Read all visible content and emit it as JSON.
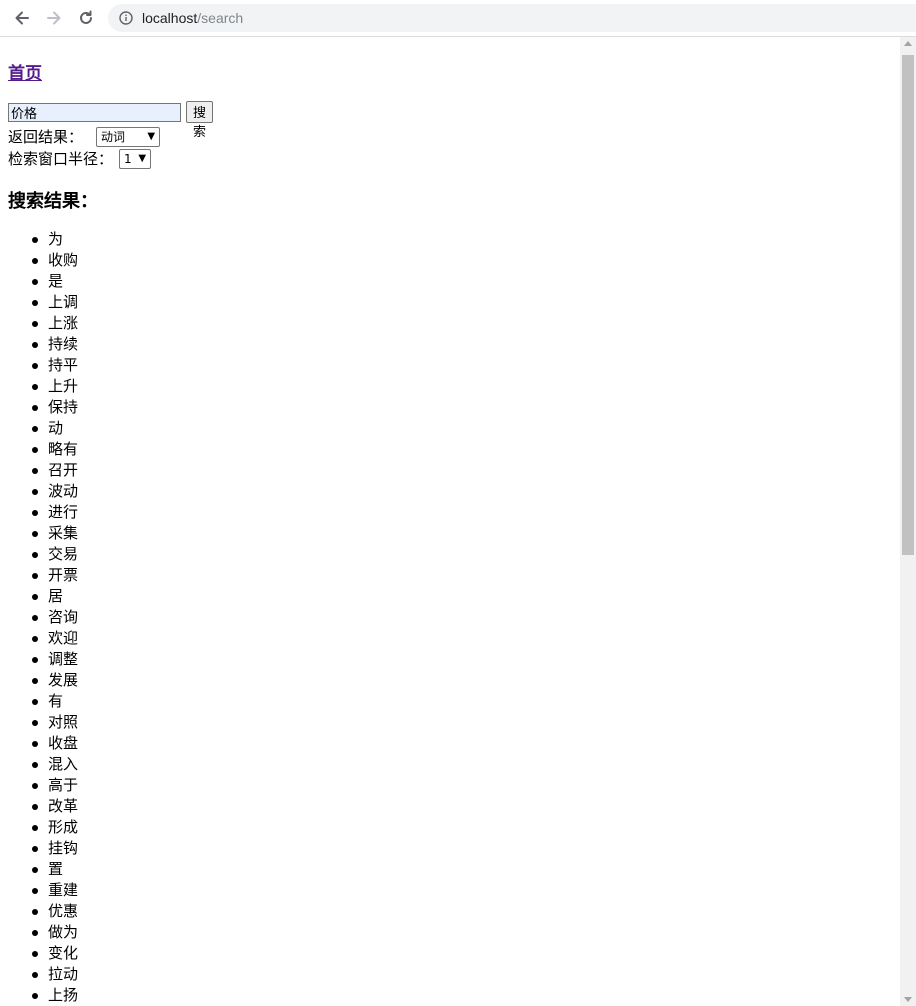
{
  "browser": {
    "url_host": "localhost",
    "url_path": "/search"
  },
  "page": {
    "home_link": "首页",
    "search_value": "价格",
    "search_button": "搜索",
    "return_label": "返回结果：",
    "return_selected": "动词",
    "window_label": "检索窗口半径：",
    "window_selected": "1",
    "results_heading": "搜索结果：",
    "results": [
      "为",
      "收购",
      "是",
      "上调",
      "上涨",
      "持续",
      "持平",
      "上升",
      "保持",
      "动",
      "略有",
      "召开",
      "波动",
      "进行",
      "采集",
      "交易",
      "开票",
      "居",
      "咨询",
      "欢迎",
      "调整",
      "发展",
      "有",
      "对照",
      "收盘",
      "混入",
      "高于",
      "改革",
      "形成",
      "挂钩",
      "置",
      "重建",
      "优惠",
      "做为",
      "变化",
      "拉动",
      "上扬"
    ]
  }
}
